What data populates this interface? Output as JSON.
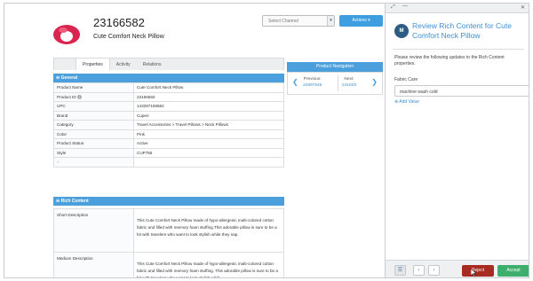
{
  "product": {
    "id": "23166582",
    "name": "Cute Comfort Neck Pillow",
    "image_icon": "neck-pillow-image"
  },
  "toolbar": {
    "channel_placeholder": "Select Channel",
    "actions_label": "Actions ▾"
  },
  "tabs": [
    "Properties",
    "Activity",
    "Relations"
  ],
  "general": {
    "title": "⊖ General",
    "rows": [
      {
        "label": "Product Name",
        "value": "Cute Comfort Neck Pillow"
      },
      {
        "label": "Product ID",
        "value": "23166582"
      },
      {
        "label": "UPC",
        "value": "143287166582"
      },
      {
        "label": "Brand",
        "value": "Cuperi"
      },
      {
        "label": "Category",
        "value": "Travel Accessories >  Travel Pillows >  Neck Pillows"
      },
      {
        "label": "Color",
        "value": "Pink"
      },
      {
        "label": "Product Status",
        "value": "Active"
      },
      {
        "label": "Style",
        "value": "CUP755"
      }
    ],
    "add_row": "+"
  },
  "rich_content": {
    "title": "⊖ Rich Content",
    "rows": [
      {
        "label": "Short Description",
        "value": "This Cute Comfort Neck Pillow made of hypo-allergenic multi-colored cotton fabric and filled with memory foam stuffing.This adorable pillow is sure to be a hit with travelers who want to look stylish while they nap."
      },
      {
        "label": "Medium Description",
        "value": "This Cute Comfort Neck Pillow made of hypo-allergenic multi-colored cotton fabric and filled with memory foam stuffing. This adorable pillow is sure to be a hit with travelers who want to look stylish while"
      }
    ]
  },
  "product_navigation": {
    "title": "Product Navigation",
    "previous_label": "Previous:",
    "previous_value": "22897545",
    "next_label": "Next:",
    "next_value": "241029"
  },
  "review_panel": {
    "avatar_initial": "M",
    "title": "Review Rich Content for Cute Comfort Neck Pillow",
    "instructions": "Please review the following updates to the Rich Content properties.",
    "field_label": "Fabric Care",
    "field_value": "machine wash cold",
    "add_value": "⊕ Add Value",
    "reject_label": "Reject",
    "accept_label": "Accept"
  },
  "colors": {
    "accent_blue": "#4a9fdc",
    "reject_red": "#a72b20",
    "accept_green": "#3eae6c"
  }
}
